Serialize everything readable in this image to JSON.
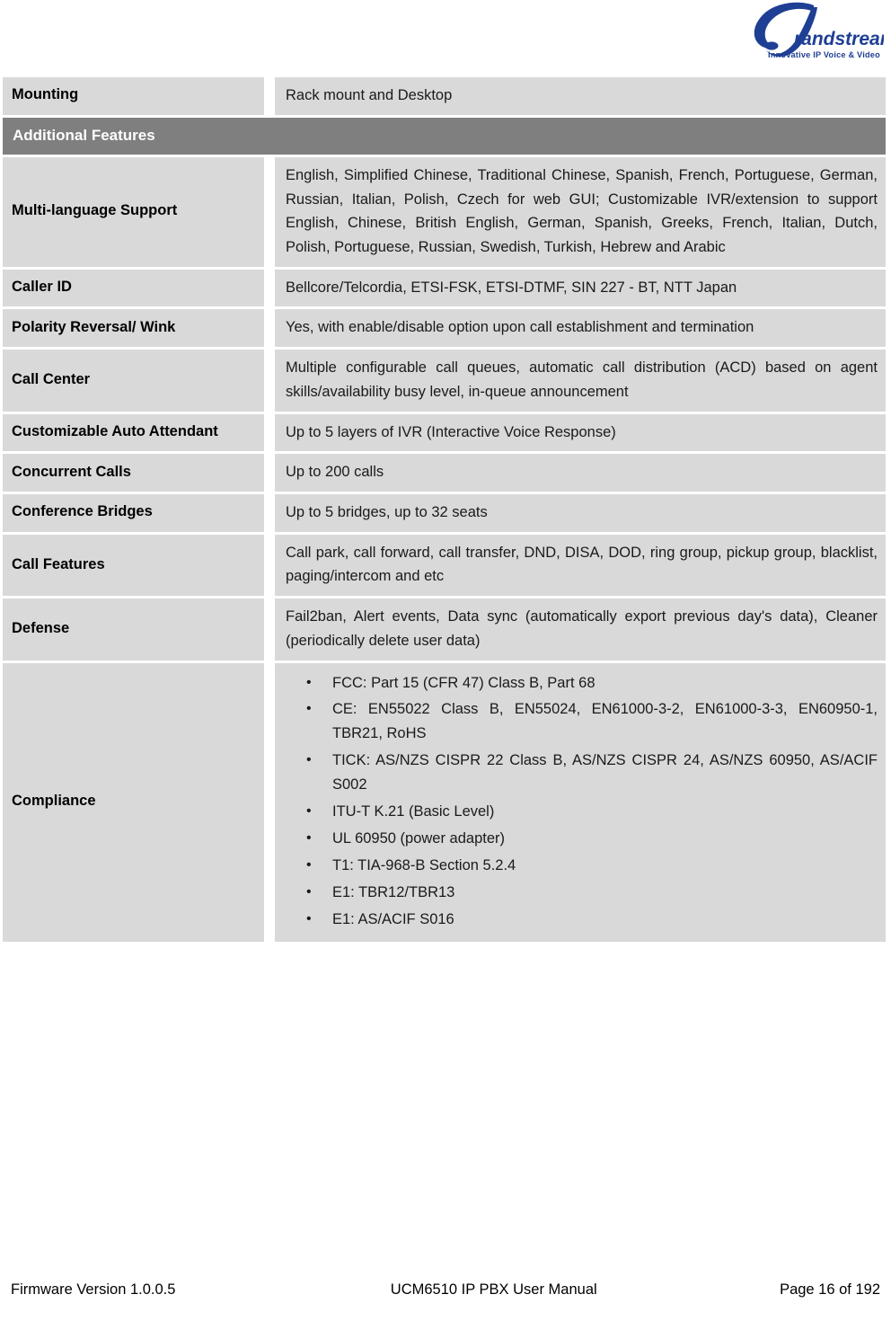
{
  "header": {
    "logo_name": "Grandstream",
    "logo_wordmark": "randstream",
    "logo_tagline": "Innovative IP Voice & Video",
    "logo_color": "#1f3f94"
  },
  "colors": {
    "row_background": "#d9d9d9",
    "section_background": "#7f7f7f",
    "section_text": "#ffffff",
    "page_background": "#ffffff"
  },
  "table": {
    "rows": [
      {
        "type": "spec",
        "label": "Mounting",
        "value": "Rack mount and Desktop"
      },
      {
        "type": "section",
        "label": "Additional Features"
      },
      {
        "type": "spec",
        "label": "Multi-language Support",
        "value": "English, Simplified Chinese, Traditional Chinese, Spanish, French, Portuguese, German, Russian, Italian, Polish, Czech for web GUI; Customizable IVR/extension to support English, Chinese, British English, German, Spanish, Greeks, French, Italian, Dutch, Polish, Portuguese, Russian, Swedish, Turkish, Hebrew and Arabic"
      },
      {
        "type": "spec",
        "label": "Caller ID",
        "value": "Bellcore/Telcordia, ETSI-FSK, ETSI-DTMF, SIN 227 - BT, NTT Japan"
      },
      {
        "type": "spec",
        "label": "Polarity Reversal/ Wink",
        "value": "Yes, with enable/disable option upon call establishment and termination"
      },
      {
        "type": "spec",
        "label": "Call Center",
        "value": "Multiple configurable call queues, automatic call distribution (ACD) based on agent skills/availability busy level, in-queue announcement"
      },
      {
        "type": "spec",
        "label": "Customizable Auto Attendant",
        "value": "Up to 5 layers of IVR (Interactive Voice Response)"
      },
      {
        "type": "spec",
        "label": "Concurrent Calls",
        "value": "Up to 200 calls"
      },
      {
        "type": "spec",
        "label": "Conference Bridges",
        "value": "Up to 5 bridges, up to 32 seats"
      },
      {
        "type": "spec",
        "label": "Call Features",
        "value": "Call park, call forward, call transfer, DND, DISA, DOD, ring group, pickup group, blacklist, paging/intercom and etc"
      },
      {
        "type": "spec",
        "label": "Defense",
        "value": "Fail2ban, Alert events, Data sync (automatically export previous day's data), Cleaner (periodically delete user data)"
      },
      {
        "type": "bullets",
        "label": "Compliance",
        "bullets": [
          "FCC: Part 15 (CFR 47) Class B, Part 68",
          "CE: EN55022 Class B, EN55024, EN61000-3-2, EN61000-3-3, EN60950-1, TBR21, RoHS",
          "TICK: AS/NZS CISPR 22 Class B, AS/NZS CISPR 24, AS/NZS 60950, AS/ACIF S002",
          "ITU-T K.21 (Basic Level)",
          "UL 60950 (power adapter)",
          "T1: TIA-968-B Section 5.2.4",
          "E1: TBR12/TBR13",
          "E1: AS/ACIF S016"
        ]
      }
    ]
  },
  "footer": {
    "firmware_version": "Firmware Version 1.0.0.5",
    "manual_title": "UCM6510 IP PBX User Manual",
    "page_number": "Page 16 of 192"
  }
}
